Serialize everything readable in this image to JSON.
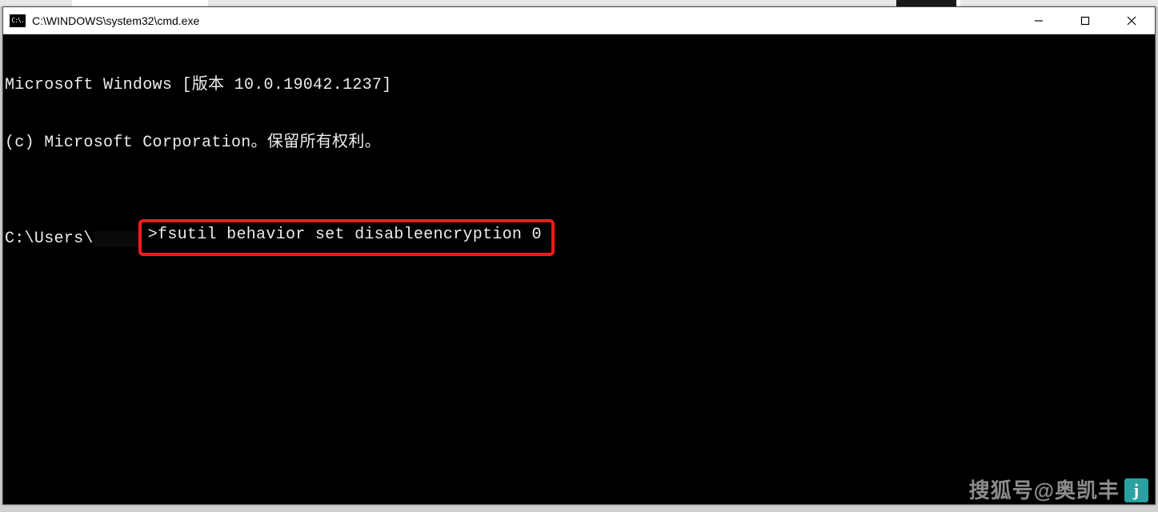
{
  "window": {
    "title": "C:\\WINDOWS\\system32\\cmd.exe",
    "icon_text": "C:\\."
  },
  "console": {
    "line1": "Microsoft Windows [版本 10.0.19042.1237]",
    "line2": "(c) Microsoft Corporation。保留所有权利。",
    "blank": "",
    "prompt_prefix": "C:\\Users\\",
    "prompt_gt": ">",
    "command": "fsutil behavior set disableencryption 0"
  },
  "watermark": {
    "text": "搜狐号@奥凯丰",
    "badge": "j"
  }
}
